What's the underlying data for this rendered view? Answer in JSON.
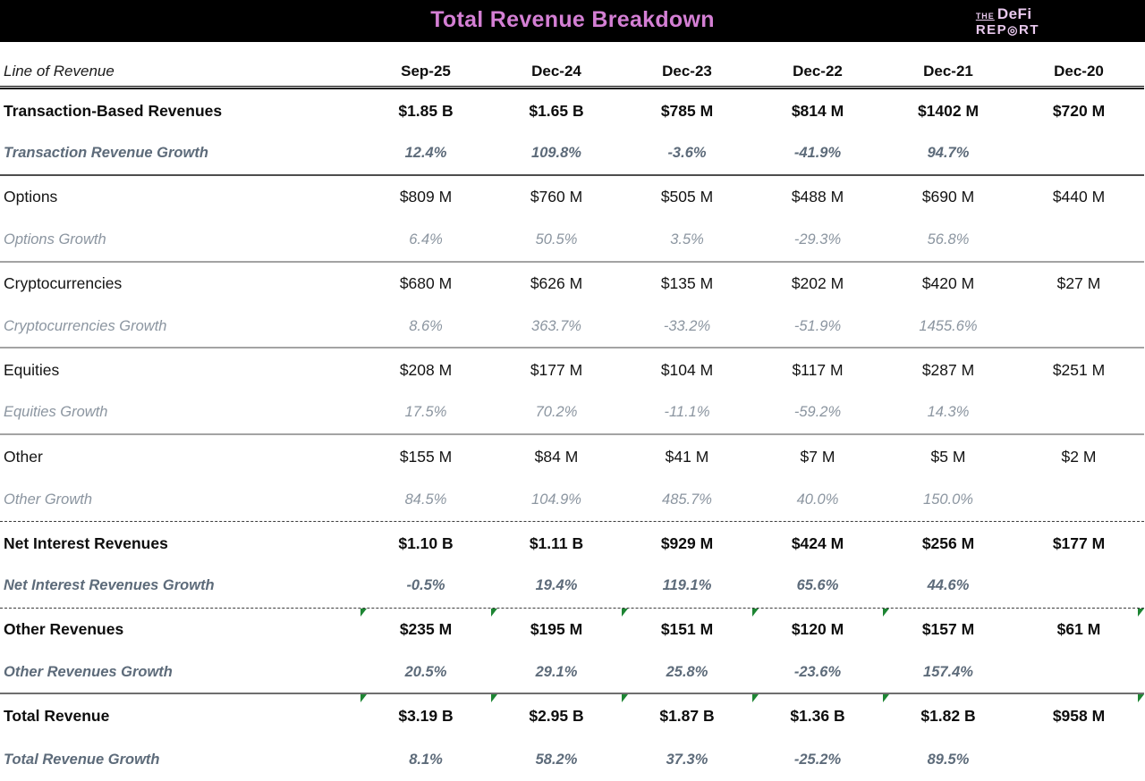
{
  "header": {
    "logo": {
      "the": "THE",
      "defi": "DeFi",
      "rep": "REP",
      "o": "◎",
      "rt": "RT"
    }
  },
  "chart_data": {
    "type": "table",
    "title": "Total Revenue Breakdown",
    "label_header": "Line of Revenue",
    "columns": [
      "Sep-25",
      "Dec-24",
      "Dec-23",
      "Dec-22",
      "Dec-21",
      "Dec-20"
    ],
    "rows": [
      {
        "label": "Transaction-Based Revenues",
        "style": "main",
        "divider": "none",
        "flags": false,
        "values": [
          "$1.85 B",
          "$1.65 B",
          "$785 M",
          "$814 M",
          "$1402 M",
          "$720 M"
        ]
      },
      {
        "label": "Transaction Revenue Growth",
        "style": "growth-strong",
        "divider": "dark",
        "flags": false,
        "values": [
          "12.4%",
          "109.8%",
          "-3.6%",
          "-41.9%",
          "94.7%",
          ""
        ]
      },
      {
        "label": "Options",
        "style": "sub",
        "divider": "none",
        "flags": false,
        "values": [
          "$809 M",
          "$760 M",
          "$505 M",
          "$488 M",
          "$690 M",
          "$440 M"
        ]
      },
      {
        "label": "Options Growth",
        "style": "growth-light",
        "divider": "gray",
        "flags": false,
        "values": [
          "6.4%",
          "50.5%",
          "3.5%",
          "-29.3%",
          "56.8%",
          ""
        ]
      },
      {
        "label": "Cryptocurrencies",
        "style": "sub",
        "divider": "none",
        "flags": false,
        "values": [
          "$680 M",
          "$626 M",
          "$135 M",
          "$202 M",
          "$420 M",
          "$27 M"
        ]
      },
      {
        "label": "Cryptocurrencies Growth",
        "style": "growth-light",
        "divider": "gray",
        "flags": false,
        "values": [
          "8.6%",
          "363.7%",
          "-33.2%",
          "-51.9%",
          "1455.6%",
          ""
        ]
      },
      {
        "label": "Equities",
        "style": "sub",
        "divider": "none",
        "flags": false,
        "values": [
          "$208 M",
          "$177 M",
          "$104 M",
          "$117 M",
          "$287 M",
          "$251 M"
        ]
      },
      {
        "label": "Equities Growth",
        "style": "growth-light",
        "divider": "gray",
        "flags": false,
        "values": [
          "17.5%",
          "70.2%",
          "-11.1%",
          "-59.2%",
          "14.3%",
          ""
        ]
      },
      {
        "label": "Other",
        "style": "sub",
        "divider": "none",
        "flags": false,
        "values": [
          "$155 M",
          "$84 M",
          "$41 M",
          "$7 M",
          "$5 M",
          "$2 M"
        ]
      },
      {
        "label": "Other Growth",
        "style": "growth-light",
        "divider": "dashed",
        "flags": false,
        "values": [
          "84.5%",
          "104.9%",
          "485.7%",
          "40.0%",
          "150.0%",
          ""
        ]
      },
      {
        "label": "Net Interest Revenues",
        "style": "main",
        "divider": "none",
        "flags": false,
        "values": [
          "$1.10 B",
          "$1.11 B",
          "$929 M",
          "$424 M",
          "$256 M",
          "$177 M"
        ]
      },
      {
        "label": "Net Interest Revenues Growth",
        "style": "growth-strong",
        "divider": "dashed",
        "flags": false,
        "values": [
          "-0.5%",
          "19.4%",
          "119.1%",
          "65.6%",
          "44.6%",
          ""
        ]
      },
      {
        "label": "Other Revenues",
        "style": "main",
        "divider": "none",
        "flags": true,
        "values": [
          "$235 M",
          "$195 M",
          "$151 M",
          "$120 M",
          "$157 M",
          "$61 M"
        ]
      },
      {
        "label": "Other Revenues Growth",
        "style": "growth-strong",
        "divider": "solidgray",
        "flags": false,
        "values": [
          "20.5%",
          "29.1%",
          "25.8%",
          "-23.6%",
          "157.4%",
          ""
        ]
      },
      {
        "label": "Total Revenue",
        "style": "main",
        "divider": "none",
        "flags": true,
        "values": [
          "$3.19 B",
          "$2.95 B",
          "$1.87 B",
          "$1.36 B",
          "$1.82 B",
          "$958 M"
        ]
      },
      {
        "label": "Total Revenue Growth",
        "style": "growth-strong",
        "divider": "none",
        "flags": false,
        "values": [
          "8.1%",
          "58.2%",
          "37.3%",
          "-25.2%",
          "89.5%",
          ""
        ]
      }
    ]
  },
  "colors": {
    "banner_bg": "#000000",
    "title_pink": "#d47fd4",
    "logo_pink": "#e9c9ee",
    "growth_strong": "#5d6b7a",
    "growth_light": "#8b95a0",
    "flag_green": "#1d8533"
  }
}
